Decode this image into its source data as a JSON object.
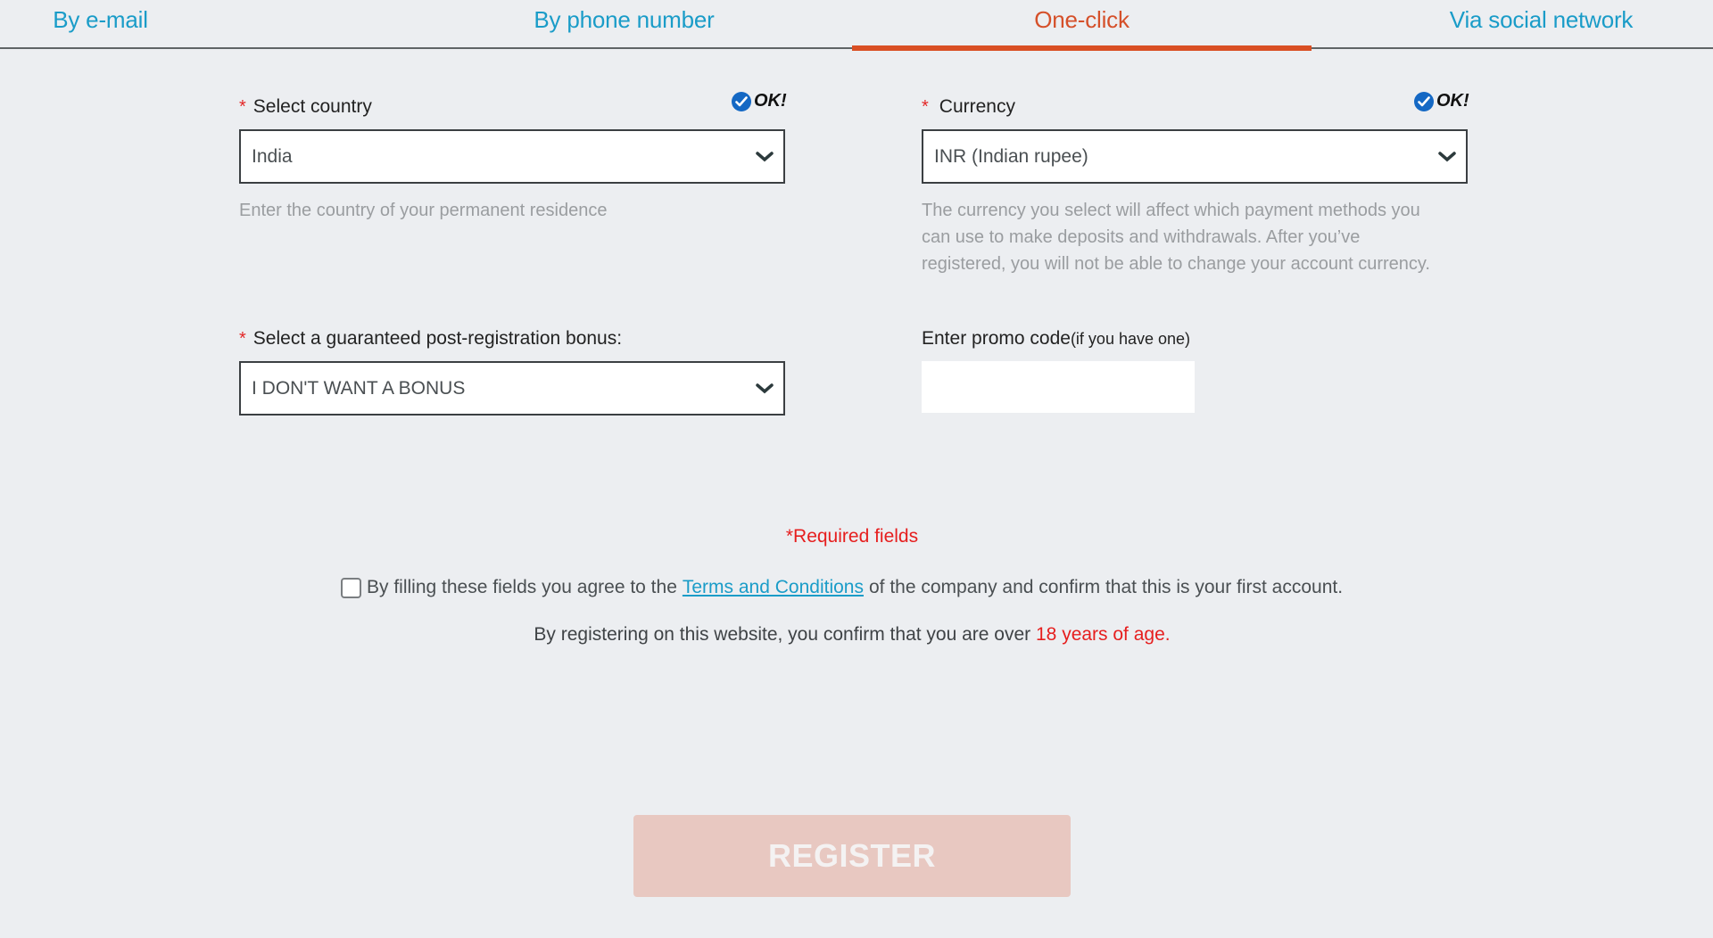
{
  "tabs": [
    {
      "label": "By e-mail",
      "active": false
    },
    {
      "label": "By phone number",
      "active": false
    },
    {
      "label": "One-click",
      "active": true
    },
    {
      "label": "Via social network",
      "active": false
    }
  ],
  "colors": {
    "tab_link": "#1a9cc8",
    "tab_active": "#d5502a",
    "required_red": "#e61e1e",
    "ok_check_blue": "#1468c4",
    "register_disabled": "#e8c8c1"
  },
  "form": {
    "country": {
      "required_mark": "*",
      "label": "Select country",
      "status": "OK!",
      "value": "India",
      "helper": "Enter the country of your permanent residence"
    },
    "currency": {
      "required_mark": "*",
      "label": "Currency",
      "status": "OK!",
      "value": "INR (Indian rupee)",
      "helper_lines": [
        "The currency you select will affect which payment methods you",
        "can use to make deposits and withdrawals. After you’ve",
        "registered, you will not be able to change your account currency."
      ]
    },
    "bonus": {
      "required_mark": "*",
      "label": "Select a guaranteed post-registration bonus:",
      "value": "I DON'T WANT A BONUS"
    },
    "promo": {
      "label": "Enter promo code",
      "label_suffix": "(if you have one)",
      "value": "",
      "placeholder": ""
    },
    "required_note": "*Required fields",
    "agree": {
      "checked": false,
      "text_before": "By filling these fields you agree to the",
      "link": "Terms and Conditions",
      "text_after": "of the company and confirm that this is your first account."
    },
    "age": {
      "text": "By registering on this website, you confirm that you are over",
      "highlight": "18 years of age."
    },
    "register_label": "REGISTER"
  }
}
